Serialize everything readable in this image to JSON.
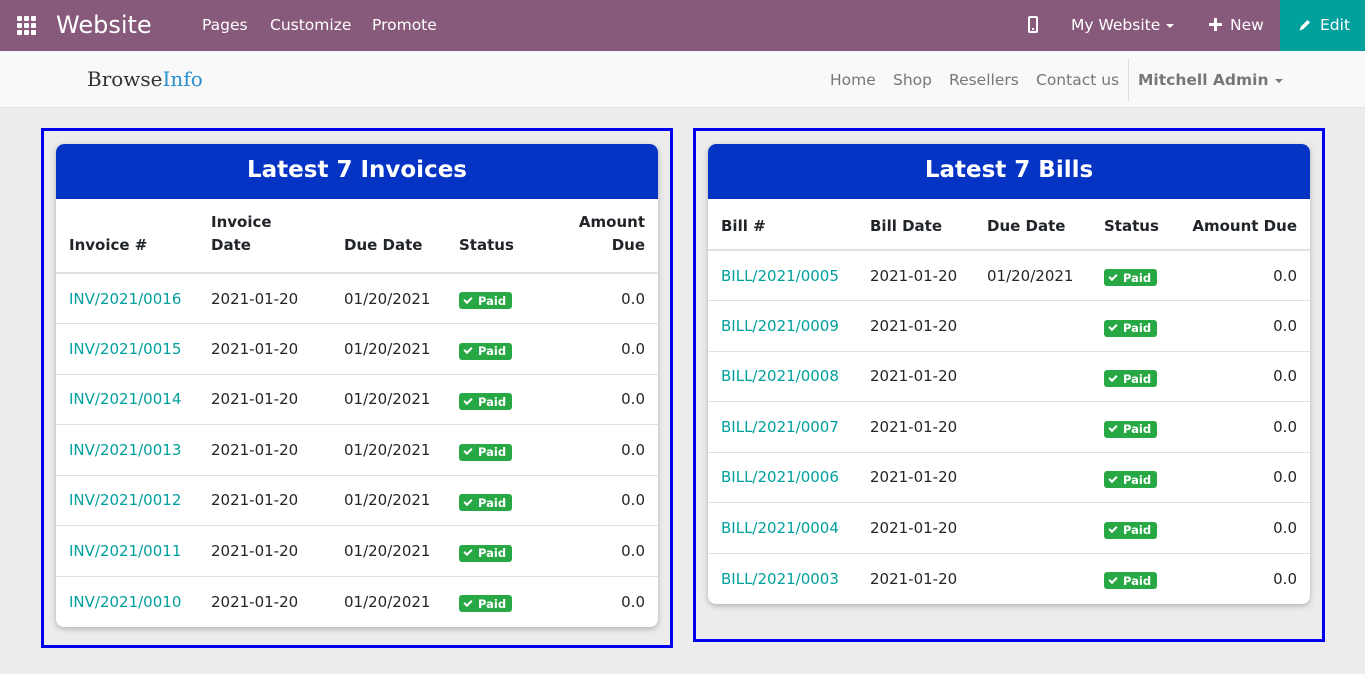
{
  "topbar": {
    "brand": "Website",
    "menu": [
      "Pages",
      "Customize",
      "Promote"
    ],
    "website_selector": "My Website",
    "new_label": "New",
    "edit_label": "Edit"
  },
  "sitenav": {
    "logo_main": "Browse",
    "logo_accent": "Info",
    "links": [
      "Home",
      "Shop",
      "Resellers",
      "Contact us"
    ],
    "user": "Mitchell Admin"
  },
  "invoices": {
    "title": "Latest 7 Invoices",
    "columns": [
      "Invoice #",
      "Invoice Date",
      "Due Date",
      "Status",
      "Amount Due"
    ],
    "column_lines": [
      [
        "Invoice #"
      ],
      [
        "Invoice",
        "Date"
      ],
      [
        "Due Date"
      ],
      [
        "Status"
      ],
      [
        "Amount",
        "Due"
      ]
    ],
    "rows": [
      {
        "number": "INV/2021/0016",
        "date": "2021-01-20",
        "due": "01/20/2021",
        "status": "Paid",
        "amount": "0.0"
      },
      {
        "number": "INV/2021/0015",
        "date": "2021-01-20",
        "due": "01/20/2021",
        "status": "Paid",
        "amount": "0.0"
      },
      {
        "number": "INV/2021/0014",
        "date": "2021-01-20",
        "due": "01/20/2021",
        "status": "Paid",
        "amount": "0.0"
      },
      {
        "number": "INV/2021/0013",
        "date": "2021-01-20",
        "due": "01/20/2021",
        "status": "Paid",
        "amount": "0.0"
      },
      {
        "number": "INV/2021/0012",
        "date": "2021-01-20",
        "due": "01/20/2021",
        "status": "Paid",
        "amount": "0.0"
      },
      {
        "number": "INV/2021/0011",
        "date": "2021-01-20",
        "due": "01/20/2021",
        "status": "Paid",
        "amount": "0.0"
      },
      {
        "number": "INV/2021/0010",
        "date": "2021-01-20",
        "due": "01/20/2021",
        "status": "Paid",
        "amount": "0.0"
      }
    ]
  },
  "bills": {
    "title": "Latest 7 Bills",
    "columns": [
      "Bill #",
      "Bill Date",
      "Due Date",
      "Status",
      "Amount Due"
    ],
    "rows": [
      {
        "number": "BILL/2021/0005",
        "date": "2021-01-20",
        "due": "01/20/2021",
        "status": "Paid",
        "amount": "0.0"
      },
      {
        "number": "BILL/2021/0009",
        "date": "2021-01-20",
        "due": "",
        "status": "Paid",
        "amount": "0.0"
      },
      {
        "number": "BILL/2021/0008",
        "date": "2021-01-20",
        "due": "",
        "status": "Paid",
        "amount": "0.0"
      },
      {
        "number": "BILL/2021/0007",
        "date": "2021-01-20",
        "due": "",
        "status": "Paid",
        "amount": "0.0"
      },
      {
        "number": "BILL/2021/0006",
        "date": "2021-01-20",
        "due": "",
        "status": "Paid",
        "amount": "0.0"
      },
      {
        "number": "BILL/2021/0004",
        "date": "2021-01-20",
        "due": "",
        "status": "Paid",
        "amount": "0.0"
      },
      {
        "number": "BILL/2021/0003",
        "date": "2021-01-20",
        "due": "",
        "status": "Paid",
        "amount": "0.0"
      }
    ]
  },
  "colors": {
    "topbar": "#875a7b",
    "edit_button": "#00a09d",
    "card_header": "#0533c4",
    "frame_border": "#0000ee",
    "link": "#00a09d",
    "paid_badge": "#28a745"
  }
}
